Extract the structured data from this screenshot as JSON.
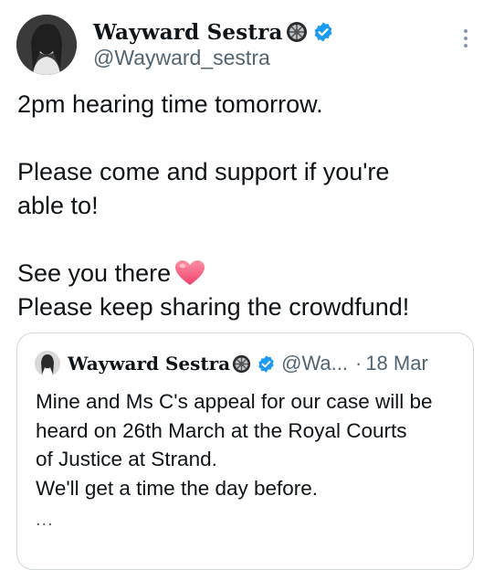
{
  "author": {
    "display_name": "Wayward Sestra",
    "handle": "@Wayward_sestra",
    "badge_icon": "wheel-emoji-icon",
    "verified_icon": "verified-badge-icon"
  },
  "tweet": {
    "lines": [
      "2pm hearing time tomorrow.",
      "",
      "Please come and support if you're",
      "able to!",
      "",
      "See you there",
      "Please keep sharing the crowdfund!"
    ],
    "emoji": "heart-emoji-icon"
  },
  "quoted": {
    "display_name": "Wayward Sestra",
    "handle": "@Wa...",
    "separator": "·",
    "date": "18 Mar",
    "lines": [
      "Mine and Ms C's appeal for our case will be",
      "heard on 26th March at the Royal Courts",
      "of Justice at Strand.",
      "We'll get a time the day before."
    ],
    "truncation": "..."
  },
  "colors": {
    "text": "#0f1419",
    "secondary": "#536471",
    "verified_blue": "#1d9bf0",
    "border": "#cfd9de",
    "heart": "#f05a7e"
  }
}
